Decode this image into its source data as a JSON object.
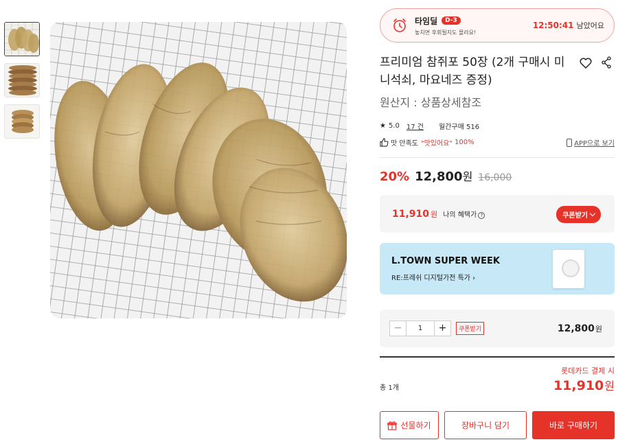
{
  "colors": {
    "accent": "#e6332a",
    "banner_bg": "#c6e8f7",
    "box_bg": "#f5f5f5"
  },
  "timedeal": {
    "title": "타임딜",
    "badge": "D-3",
    "subtitle": "놓치면 후회될지도 몰라요!",
    "time": "12:50:41",
    "left_label": "남았어요",
    "icon": "alarm-clock-icon"
  },
  "product": {
    "title": "프리미엄 참쥐포 50장 (2개 구매시 미니석쇠, 마요네즈 증정)",
    "origin": "원산지 : 상품상세참조",
    "rating": "5.0",
    "review_count": "17 건",
    "monthly_purchase": "월간구매 516",
    "satisfaction_label": "맛 만족도",
    "satisfaction_value": "\"맛있어요\"",
    "satisfaction_pct": "100%",
    "app_link": "APP으로 보기",
    "icons": [
      "heart-icon",
      "share-icon",
      "thumbs-up-icon",
      "phone-icon"
    ]
  },
  "price": {
    "discount": "20%",
    "sale": "12,800",
    "won": "원",
    "original": "16,000"
  },
  "benefit": {
    "price": "11,910",
    "won": "원",
    "label": "나의 혜택가",
    "coupon_button": "쿠폰받기"
  },
  "banner": {
    "title": "L.TOWN SUPER WEEK",
    "subtitle": "RE:프레쉬 디지털가전 특가 "
  },
  "quantity": {
    "minus": "−",
    "value": "1",
    "plus": "+",
    "coupon_tag": "쿠폰받기",
    "price": "12,800",
    "won": "원"
  },
  "total": {
    "count": "총 1개",
    "card_note": "롯데카드 결제 시",
    "price": "11,910",
    "won": "원"
  },
  "buttons": {
    "gift": "선물하기",
    "cart": "장바구니 담기",
    "buy": "바로 구매하기"
  }
}
